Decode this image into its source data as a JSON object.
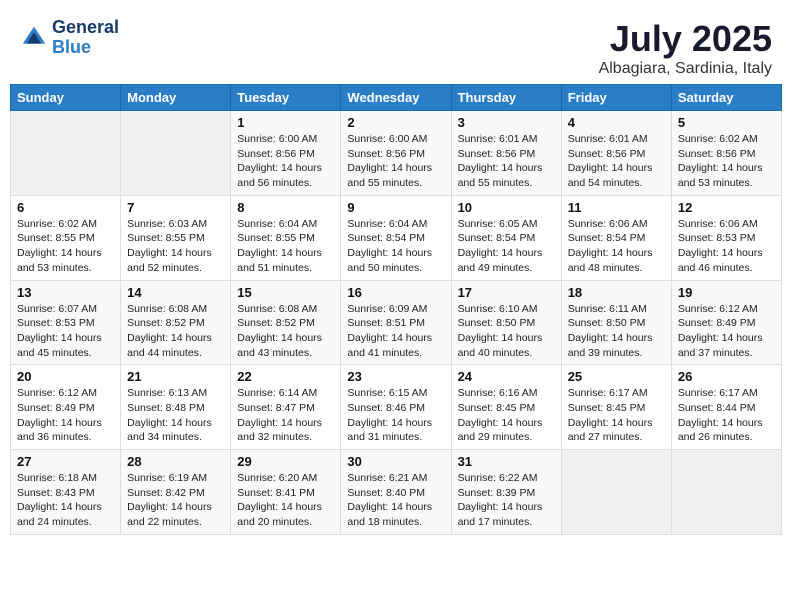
{
  "logo": {
    "line1": "General",
    "line2": "Blue"
  },
  "title": "July 2025",
  "location": "Albagiara, Sardinia, Italy",
  "weekdays": [
    "Sunday",
    "Monday",
    "Tuesday",
    "Wednesday",
    "Thursday",
    "Friday",
    "Saturday"
  ],
  "weeks": [
    [
      {
        "day": "",
        "sunrise": "",
        "sunset": "",
        "daylight": ""
      },
      {
        "day": "",
        "sunrise": "",
        "sunset": "",
        "daylight": ""
      },
      {
        "day": "1",
        "sunrise": "Sunrise: 6:00 AM",
        "sunset": "Sunset: 8:56 PM",
        "daylight": "Daylight: 14 hours and 56 minutes."
      },
      {
        "day": "2",
        "sunrise": "Sunrise: 6:00 AM",
        "sunset": "Sunset: 8:56 PM",
        "daylight": "Daylight: 14 hours and 55 minutes."
      },
      {
        "day": "3",
        "sunrise": "Sunrise: 6:01 AM",
        "sunset": "Sunset: 8:56 PM",
        "daylight": "Daylight: 14 hours and 55 minutes."
      },
      {
        "day": "4",
        "sunrise": "Sunrise: 6:01 AM",
        "sunset": "Sunset: 8:56 PM",
        "daylight": "Daylight: 14 hours and 54 minutes."
      },
      {
        "day": "5",
        "sunrise": "Sunrise: 6:02 AM",
        "sunset": "Sunset: 8:56 PM",
        "daylight": "Daylight: 14 hours and 53 minutes."
      }
    ],
    [
      {
        "day": "6",
        "sunrise": "Sunrise: 6:02 AM",
        "sunset": "Sunset: 8:55 PM",
        "daylight": "Daylight: 14 hours and 53 minutes."
      },
      {
        "day": "7",
        "sunrise": "Sunrise: 6:03 AM",
        "sunset": "Sunset: 8:55 PM",
        "daylight": "Daylight: 14 hours and 52 minutes."
      },
      {
        "day": "8",
        "sunrise": "Sunrise: 6:04 AM",
        "sunset": "Sunset: 8:55 PM",
        "daylight": "Daylight: 14 hours and 51 minutes."
      },
      {
        "day": "9",
        "sunrise": "Sunrise: 6:04 AM",
        "sunset": "Sunset: 8:54 PM",
        "daylight": "Daylight: 14 hours and 50 minutes."
      },
      {
        "day": "10",
        "sunrise": "Sunrise: 6:05 AM",
        "sunset": "Sunset: 8:54 PM",
        "daylight": "Daylight: 14 hours and 49 minutes."
      },
      {
        "day": "11",
        "sunrise": "Sunrise: 6:06 AM",
        "sunset": "Sunset: 8:54 PM",
        "daylight": "Daylight: 14 hours and 48 minutes."
      },
      {
        "day": "12",
        "sunrise": "Sunrise: 6:06 AM",
        "sunset": "Sunset: 8:53 PM",
        "daylight": "Daylight: 14 hours and 46 minutes."
      }
    ],
    [
      {
        "day": "13",
        "sunrise": "Sunrise: 6:07 AM",
        "sunset": "Sunset: 8:53 PM",
        "daylight": "Daylight: 14 hours and 45 minutes."
      },
      {
        "day": "14",
        "sunrise": "Sunrise: 6:08 AM",
        "sunset": "Sunset: 8:52 PM",
        "daylight": "Daylight: 14 hours and 44 minutes."
      },
      {
        "day": "15",
        "sunrise": "Sunrise: 6:08 AM",
        "sunset": "Sunset: 8:52 PM",
        "daylight": "Daylight: 14 hours and 43 minutes."
      },
      {
        "day": "16",
        "sunrise": "Sunrise: 6:09 AM",
        "sunset": "Sunset: 8:51 PM",
        "daylight": "Daylight: 14 hours and 41 minutes."
      },
      {
        "day": "17",
        "sunrise": "Sunrise: 6:10 AM",
        "sunset": "Sunset: 8:50 PM",
        "daylight": "Daylight: 14 hours and 40 minutes."
      },
      {
        "day": "18",
        "sunrise": "Sunrise: 6:11 AM",
        "sunset": "Sunset: 8:50 PM",
        "daylight": "Daylight: 14 hours and 39 minutes."
      },
      {
        "day": "19",
        "sunrise": "Sunrise: 6:12 AM",
        "sunset": "Sunset: 8:49 PM",
        "daylight": "Daylight: 14 hours and 37 minutes."
      }
    ],
    [
      {
        "day": "20",
        "sunrise": "Sunrise: 6:12 AM",
        "sunset": "Sunset: 8:49 PM",
        "daylight": "Daylight: 14 hours and 36 minutes."
      },
      {
        "day": "21",
        "sunrise": "Sunrise: 6:13 AM",
        "sunset": "Sunset: 8:48 PM",
        "daylight": "Daylight: 14 hours and 34 minutes."
      },
      {
        "day": "22",
        "sunrise": "Sunrise: 6:14 AM",
        "sunset": "Sunset: 8:47 PM",
        "daylight": "Daylight: 14 hours and 32 minutes."
      },
      {
        "day": "23",
        "sunrise": "Sunrise: 6:15 AM",
        "sunset": "Sunset: 8:46 PM",
        "daylight": "Daylight: 14 hours and 31 minutes."
      },
      {
        "day": "24",
        "sunrise": "Sunrise: 6:16 AM",
        "sunset": "Sunset: 8:45 PM",
        "daylight": "Daylight: 14 hours and 29 minutes."
      },
      {
        "day": "25",
        "sunrise": "Sunrise: 6:17 AM",
        "sunset": "Sunset: 8:45 PM",
        "daylight": "Daylight: 14 hours and 27 minutes."
      },
      {
        "day": "26",
        "sunrise": "Sunrise: 6:17 AM",
        "sunset": "Sunset: 8:44 PM",
        "daylight": "Daylight: 14 hours and 26 minutes."
      }
    ],
    [
      {
        "day": "27",
        "sunrise": "Sunrise: 6:18 AM",
        "sunset": "Sunset: 8:43 PM",
        "daylight": "Daylight: 14 hours and 24 minutes."
      },
      {
        "day": "28",
        "sunrise": "Sunrise: 6:19 AM",
        "sunset": "Sunset: 8:42 PM",
        "daylight": "Daylight: 14 hours and 22 minutes."
      },
      {
        "day": "29",
        "sunrise": "Sunrise: 6:20 AM",
        "sunset": "Sunset: 8:41 PM",
        "daylight": "Daylight: 14 hours and 20 minutes."
      },
      {
        "day": "30",
        "sunrise": "Sunrise: 6:21 AM",
        "sunset": "Sunset: 8:40 PM",
        "daylight": "Daylight: 14 hours and 18 minutes."
      },
      {
        "day": "31",
        "sunrise": "Sunrise: 6:22 AM",
        "sunset": "Sunset: 8:39 PM",
        "daylight": "Daylight: 14 hours and 17 minutes."
      },
      {
        "day": "",
        "sunrise": "",
        "sunset": "",
        "daylight": ""
      },
      {
        "day": "",
        "sunrise": "",
        "sunset": "",
        "daylight": ""
      }
    ]
  ]
}
